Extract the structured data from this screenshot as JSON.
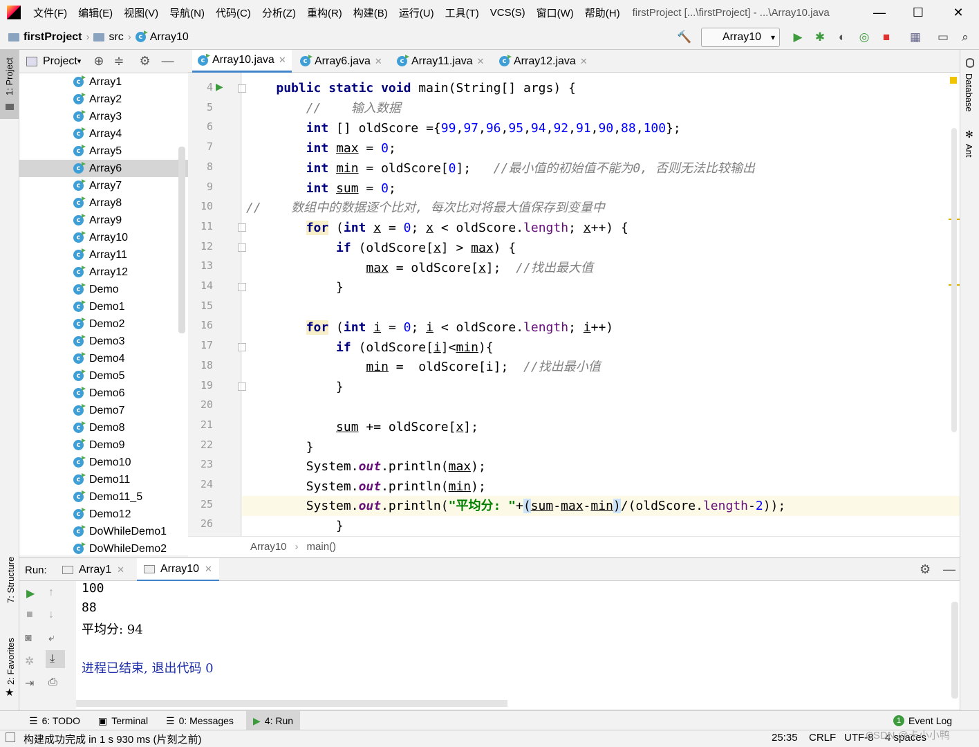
{
  "menubar": {
    "items": [
      "文件(F)",
      "编辑(E)",
      "视图(V)",
      "导航(N)",
      "代码(C)",
      "分析(Z)",
      "重构(R)",
      "构建(B)",
      "运行(U)",
      "工具(T)",
      "VCS(S)",
      "窗口(W)",
      "帮助(H)"
    ],
    "window_title": "firstProject [...\\firstProject] - ...\\Array10.java",
    "minimize": "—",
    "maximize": "☐",
    "close": "✕"
  },
  "navbar": {
    "project": "firstProject",
    "folder": "src",
    "file": "Array10",
    "run_config": "Array10"
  },
  "left_strip": {
    "project": "1: Project",
    "structure": "7: Structure",
    "favorites": "2: Favorites"
  },
  "right_strip": {
    "database": "Database",
    "ant": "Ant"
  },
  "project_panel": {
    "title": "Project",
    "items": [
      "Array1",
      "Array2",
      "Array3",
      "Array4",
      "Array5",
      "Array6",
      "Array7",
      "Array8",
      "Array9",
      "Array10",
      "Array11",
      "Array12",
      "Demo",
      "Demo1",
      "Demo2",
      "Demo3",
      "Demo4",
      "Demo5",
      "Demo6",
      "Demo7",
      "Demo8",
      "Demo9",
      "Demo10",
      "Demo11",
      "Demo11_5",
      "Demo12",
      "DoWhileDemo1",
      "DoWhileDemo2"
    ],
    "selected": "Array6"
  },
  "tabs": [
    {
      "label": "Array10.java",
      "active": true
    },
    {
      "label": "Array6.java"
    },
    {
      "label": "Array11.java"
    },
    {
      "label": "Array12.java"
    }
  ],
  "editor": {
    "line_numbers": [
      "4",
      "5",
      "6",
      "7",
      "8",
      "9",
      "10",
      "11",
      "12",
      "13",
      "14",
      "15",
      "16",
      "17",
      "18",
      "19",
      "20",
      "21",
      "22",
      "23",
      "24",
      "25",
      "26"
    ],
    "comment_input": "//    输入数据",
    "comment_min": "//最小值的初始值不能为0, 否则无法比较输出",
    "comment_loop": "//    数组中的数据逐个比对, 每次比对将最大值保存到变量中",
    "comment_findmax": "//找出最大值",
    "comment_findmin": "//找出最小值",
    "avg_string": "\"平均分: \""
  },
  "editor_breadcrumb": {
    "cls": "Array10",
    "method": "main()"
  },
  "run_panel": {
    "label": "Run:",
    "tabs": [
      "Array1",
      "Array10"
    ],
    "output": [
      "100",
      "88",
      "平均分: 94",
      "",
      "进程已结束, 退出代码 0"
    ]
  },
  "bottom_tabs": [
    "6: TODO",
    "Terminal",
    "0: Messages",
    "4: Run"
  ],
  "event_log": "Event Log",
  "status": {
    "message": "构建成功完成 in 1 s 930 ms (片刻之前)",
    "position": "25:35",
    "line_sep": "CRLF",
    "encoding": "UTF-8",
    "indent": "4 spaces",
    "watermark": "CSDN @卡小小鸭"
  },
  "colors": {
    "keyword": "#000080",
    "number": "#0000ff",
    "comment": "#808080",
    "string": "#008000",
    "field": "#660e7a",
    "accent": "#4083c9"
  }
}
